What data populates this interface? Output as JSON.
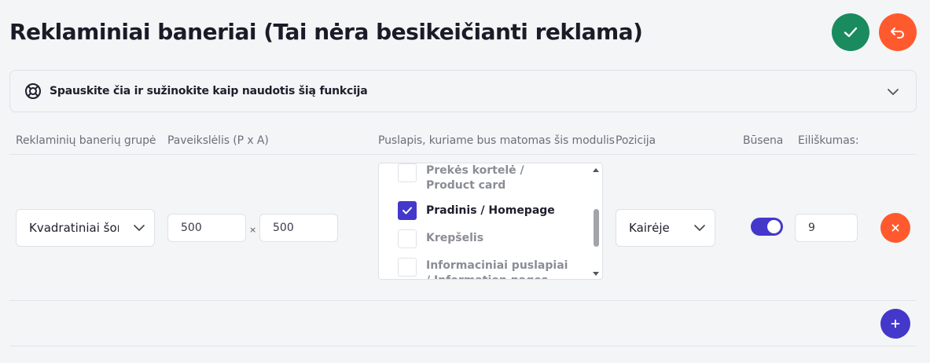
{
  "page": {
    "title": "Reklaminiai baneriai (Tai nėra besikeičianti reklama)"
  },
  "toolbar": {
    "save_icon": "check-icon",
    "back_icon": "undo-arrow-icon",
    "save_color": "#1a8a5f",
    "back_color": "#ff5a2e"
  },
  "help": {
    "icon": "lifebuoy-icon",
    "text": "Spauskite čia ir sužinokite kaip naudotis šią funkcija"
  },
  "table": {
    "headers": {
      "group": "Reklaminių banerių grupė",
      "image": "Paveikslėlis (P x A)",
      "page": "Puslapis, kuriame bus matomas šis modulis",
      "position": "Pozicija",
      "status": "Būsena",
      "order": "Eiliškumas:"
    },
    "row": {
      "group_value": "Kvadratiniai šoni",
      "width": "500",
      "height": "500",
      "times": "×",
      "pages": [
        {
          "label": "Prekės kortelė / Product card",
          "checked": false
        },
        {
          "label": "Pradinis / Homepage",
          "checked": true
        },
        {
          "label": "Krepšelis",
          "checked": false
        },
        {
          "label": "Informaciniai puslapiai / Information pages",
          "checked": false
        }
      ],
      "position_value": "Kairėje",
      "status_on": true,
      "order_value": "9"
    }
  },
  "actions": {
    "delete_color": "#ff5a2e",
    "add_color": "#4338ca"
  }
}
